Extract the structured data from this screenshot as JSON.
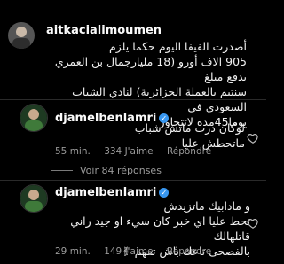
{
  "comment1": {
    "username": "aitkacialimoumen",
    "lines": [
      "أصدرت الفيفا اليوم حكما يلزم",
      "905 الاف أورو (18 مليارجمال بن العمري بدفع مبلغ",
      "سنتيم بالعملة الجزائرية) لنادي الشباب السعودي في",
      "يوما45مدة لاتتجاوز"
    ]
  },
  "reply1": {
    "username": "djamelbenlamri",
    "lines": [
      "لوكان درت ماتش شباب",
      "ماتحطش عليا"
    ],
    "time": "55 min.",
    "likes": "334 J'aime",
    "reply_label": "Répondre"
  },
  "view_replies": "Voir 84 réponses",
  "reply2": {
    "username": "djamelbenlamri",
    "lines": [
      "و مادابيك ماتزيدش",
      "تحط عليا اي خبر كان سيء او جيد راني قاتلهالك",
      "بالفصحى تاعك باش تفهم ✌"
    ],
    "time": "29 min.",
    "likes": "149 J'aime",
    "reply_label": "Répondre"
  },
  "colors": {
    "background": "#000000",
    "verified": "#3897f0",
    "meta": "#9a9a9a"
  }
}
